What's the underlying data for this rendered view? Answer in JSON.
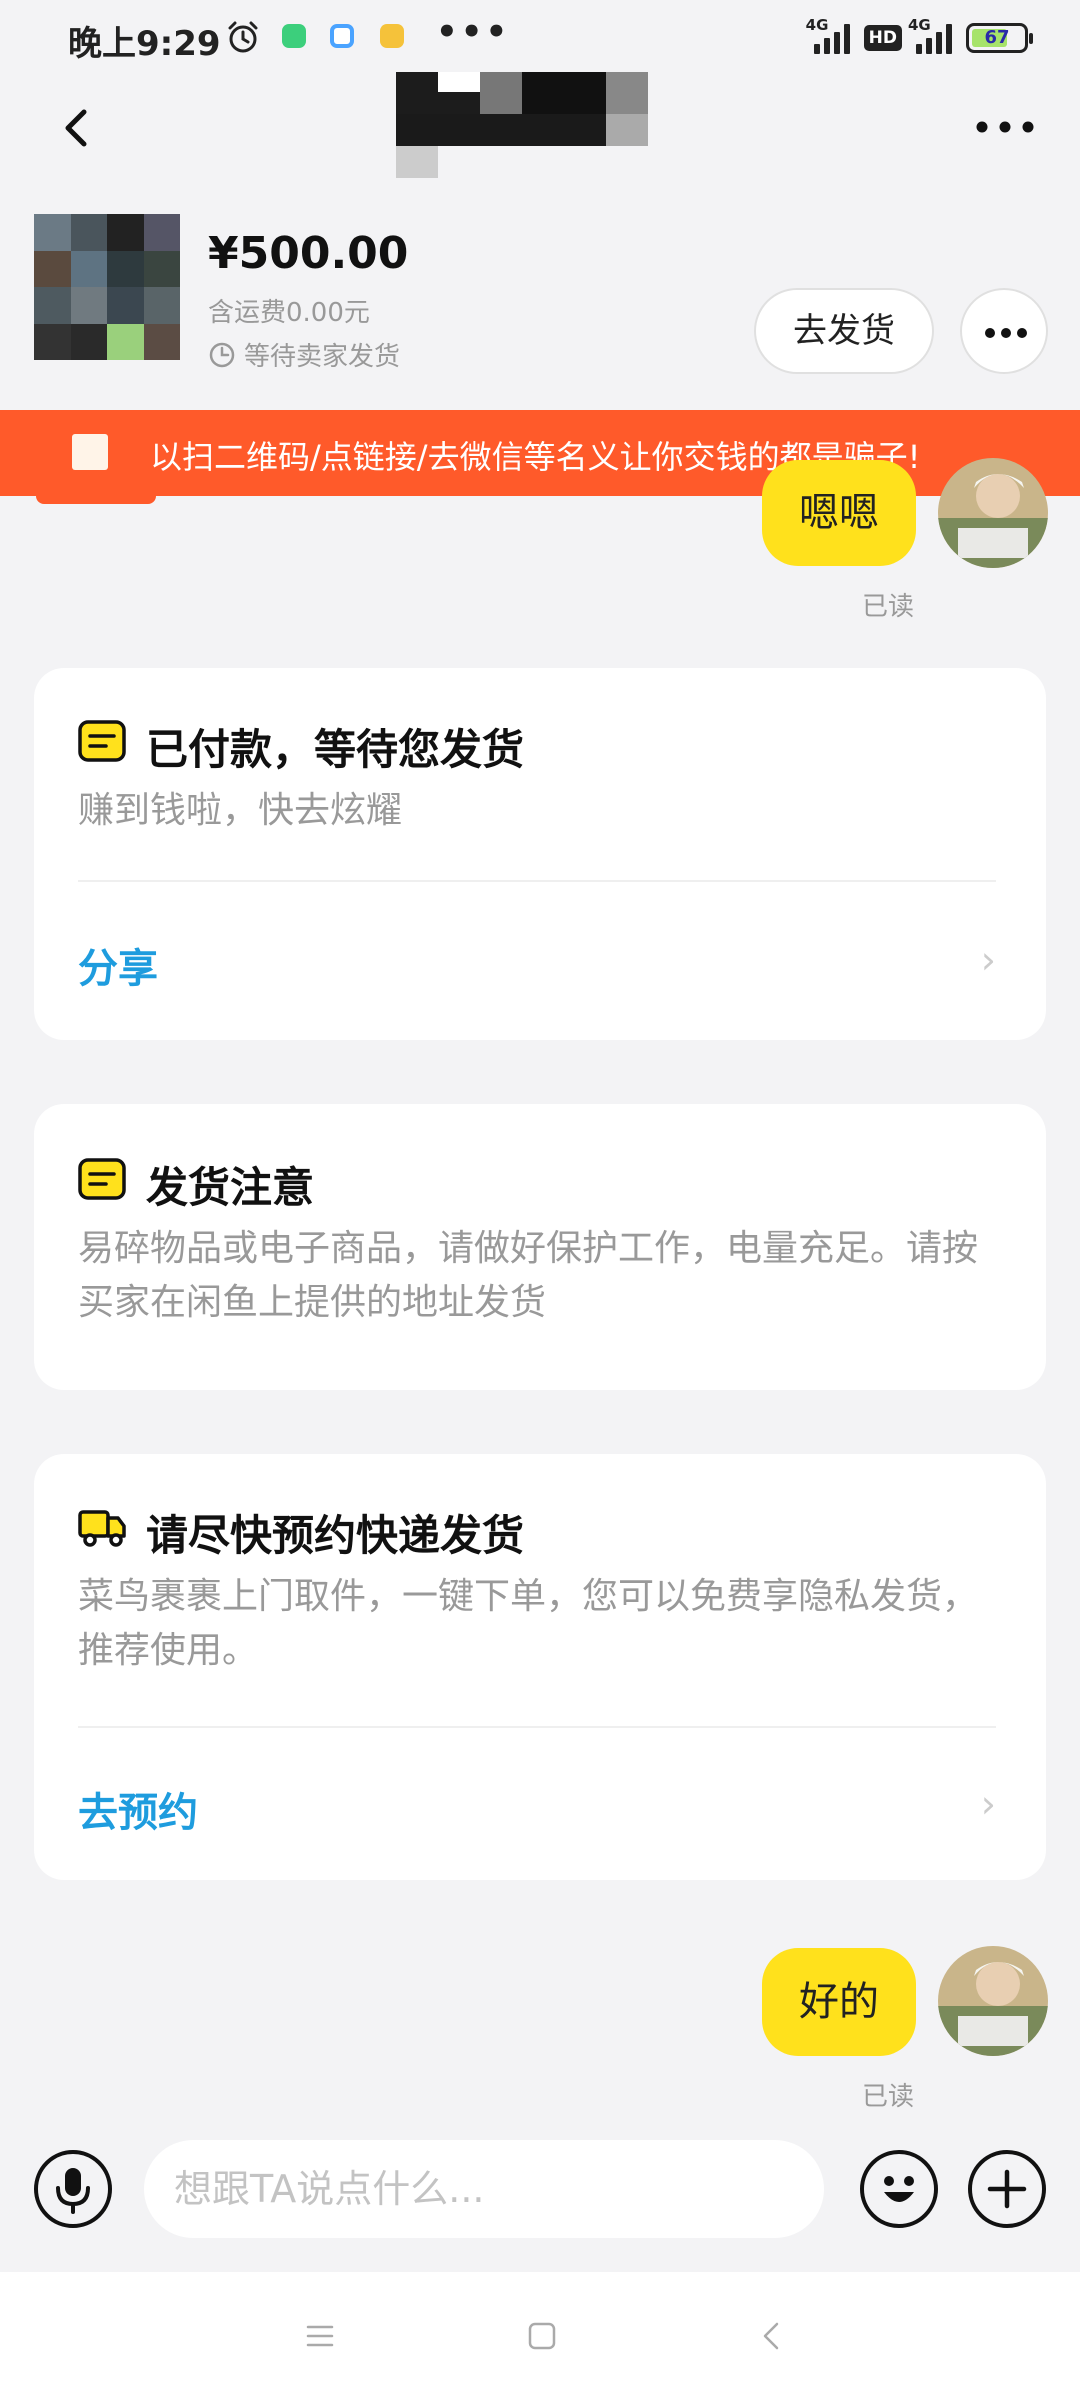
{
  "status_bar": {
    "time": "晚上9:29",
    "signal_1_label": "4G",
    "signal_2_label": "4G",
    "hd_label": "HD",
    "battery_level": "67",
    "more": "•••"
  },
  "nav": {
    "back_icon": "chevron-left-icon",
    "title_redacted": true,
    "more_icon": "more-horizontal-icon"
  },
  "order": {
    "price": "¥500.00",
    "shipping": "含运费0.00元",
    "status": "等待卖家发货",
    "ship_button": "去发货"
  },
  "warning": {
    "text": "以扫二维码/点链接/去微信等名义让你交钱的都是骗子!"
  },
  "messages": [
    {
      "text": "嗯嗯",
      "read": "已读"
    },
    {
      "text": "好的",
      "read": "已读"
    }
  ],
  "cards": {
    "paid": {
      "title": "已付款，等待您发货",
      "desc": "赚到钱啦，快去炫耀",
      "link": "分享"
    },
    "notice": {
      "title": "发货注意",
      "desc": "易碎物品或电子商品，请做好保护工作，电量充足。请按买家在闲鱼上提供的地址发货"
    },
    "express": {
      "title": "请尽快预约快递发货",
      "desc": "菜鸟裹裹上门取件，一键下单，您可以免费享隐私发货，推荐使用。",
      "link": "去预约"
    }
  },
  "input": {
    "placeholder": "想跟TA说点什么..."
  },
  "colors": {
    "accent_yellow": "#ffe11c",
    "warning_orange": "#ff5a2a",
    "link_blue": "#1e9cde",
    "background": "#f3f3f5"
  }
}
